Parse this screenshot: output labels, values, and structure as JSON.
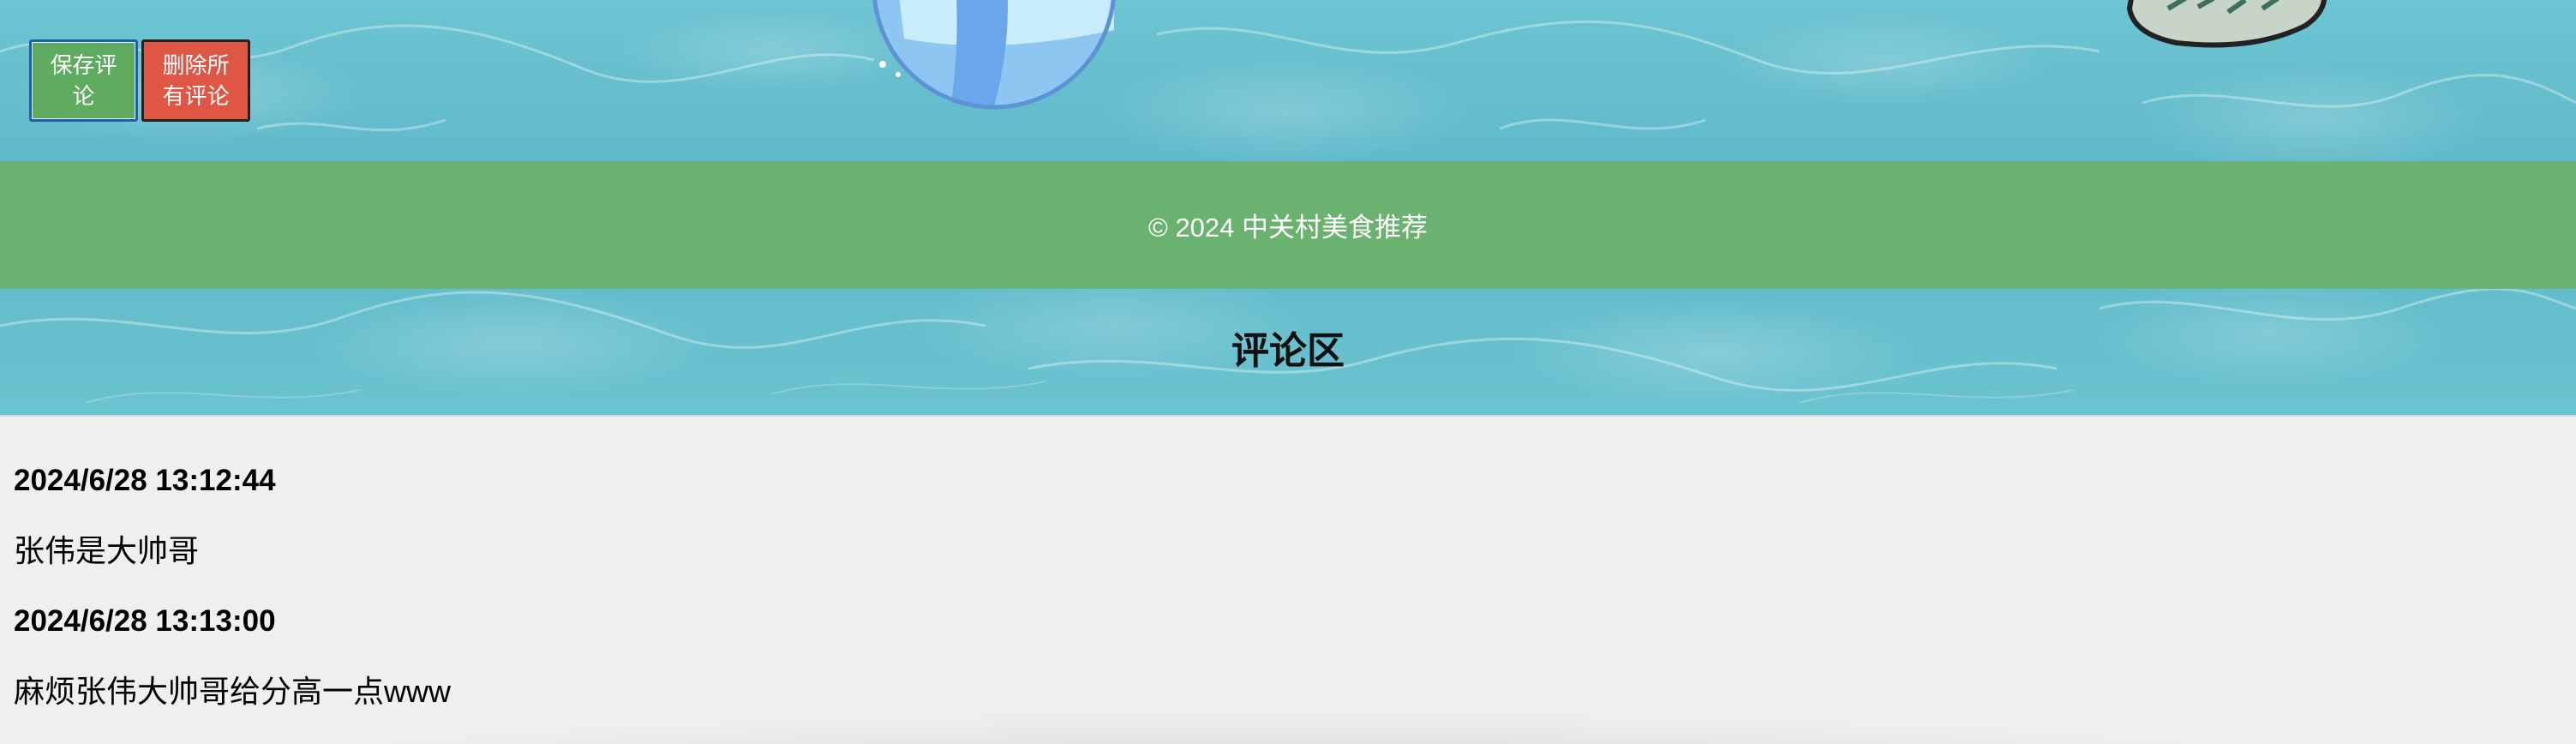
{
  "toolbar": {
    "save_label": "保存评论",
    "delete_all_label": "删除所有评论"
  },
  "footer": {
    "copyright": "© 2024 中关村美食推荐"
  },
  "comments_section": {
    "title": "评论区",
    "items": [
      {
        "time": "2024/6/28 13:12:44",
        "text": "张伟是大帅哥"
      },
      {
        "time": "2024/6/28 13:13:00",
        "text": "麻烦张伟大帅哥给分高一点www"
      }
    ]
  },
  "colors": {
    "save_button": "#5fab5f",
    "delete_button": "#e05644",
    "footer_band": "#6bb26c",
    "pool_water": "#5db8c8",
    "page_background": "#efefef"
  },
  "decorations": {
    "background_image": "pool-water-background",
    "ball_icon": "beach-ball-icon",
    "sticker_icon": "cartoon-sticker-icon"
  }
}
